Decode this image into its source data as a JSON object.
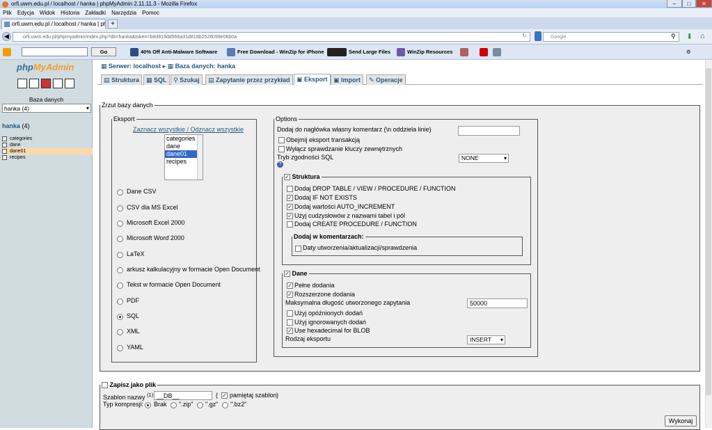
{
  "window": {
    "title": "orfi.uwm.edu.pl / localhost / hanka | phpMyAdmin 2.11.11.3 - Mozilla Firefox",
    "menu": [
      "Plik",
      "Edycja",
      "Widok",
      "Historia",
      "Zakładki",
      "Narzędzia",
      "Pomoc"
    ],
    "tab_title": "orfi.uwm.edu.pl / localhost / hanka | ph...",
    "new_tab": "+",
    "url": "orfi.uwm.edu.pl/phpmyadmin/index.php?db=hanka&token=b8d819dd566a31d818b2528099e06b0a",
    "search_placeholder": "Google"
  },
  "toolbar": {
    "go_label": "Go",
    "items": [
      "40% Off Anti-Malware Software",
      "Free Download - WinZip for iPhone",
      "Send Large Files",
      "WinZip Resources"
    ]
  },
  "sidebar": {
    "logo_a": "php",
    "logo_b": "MyAdmin",
    "db_label": "Baza danych",
    "db_select": "hanka (4)",
    "db_name": "hanka",
    "db_count": "(4)",
    "tables": [
      "categories",
      "dane",
      "dane01",
      "recipes"
    ]
  },
  "breadcrumb": {
    "server": "Serwer: localhost",
    "sep": "▸",
    "db": "Baza danych: hanka"
  },
  "tabs": [
    "Struktura",
    "SQL",
    "Szukaj",
    "Zapytanie przez przykład",
    "Eksport",
    "Import",
    "Operacje"
  ],
  "dump": {
    "legend": "Zrzut bazy danych",
    "export": {
      "legend": "Eksport",
      "select_all": "Zaznacz wszystkie / Odznacz wszystkie",
      "tables": [
        "categories",
        "dane",
        "dane01",
        "recipes"
      ],
      "formats": [
        "Dane CSV",
        "CSV dla MS Excel",
        "Microsoft Excel 2000",
        "Microsoft Word 2000",
        "LaTeX",
        "arkusz kalkulacyjny w formacie Open Document",
        "Tekst w formacie Open Document",
        "PDF",
        "SQL",
        "XML",
        "YAML"
      ]
    },
    "options": {
      "legend": "Options",
      "comment_label": "Dodaj do nagłówka własny komentarz (\\n oddziela linie)",
      "transaction": "Obejmij eksport transakcją",
      "fk": "Wyłącz sprawdzanie kluczy zewnętrznych",
      "compat_label": "Tryb zgodności SQL",
      "compat_value": "NONE",
      "help": "?",
      "struct": {
        "legend": "Struktura",
        "items": [
          "Dodaj DROP TABLE / VIEW / PROCEDURE / FUNCTION",
          "Dodaj IF NOT EXISTS",
          "Dodaj wartości AUTO_INCREMENT",
          "Użyj cudzysłowów z nazwami tabel i pól",
          "Dodaj CREATE PROCEDURE / FUNCTION"
        ],
        "comments_legend": "Dodaj w komentarzach:",
        "comments_item": "Daty utworzenia/aktualizacji/sprawdzenia"
      },
      "data": {
        "legend": "Dane",
        "full": "Pełne dodania",
        "extended": "Rozszerzone dodania",
        "maxlen_label": "Maksymalna długość utworzonego zapytania",
        "maxlen_value": "50000",
        "delayed": "Użyj opóźnionych dodań",
        "ignore": "Użyj ignorowanych dodań",
        "hex": "Use hexadecimal for BLOB",
        "type_label": "Rodzaj eksportu",
        "type_value": "INSERT"
      }
    }
  },
  "save": {
    "legend": "Zapisz jako plik",
    "template_label": "Szablon nazwy",
    "template_sup": "(1)",
    "template_colon": ":",
    "template_value": "__DB__",
    "paren_open": "(",
    "remember": "pamiętaj szablon",
    "paren_close": ")",
    "compress_label": "Typ kompresji:",
    "compress": [
      "Brak",
      "\".zip\"",
      "\".gz\"",
      "\".bz2\""
    ]
  },
  "submit": "Wykonaj"
}
